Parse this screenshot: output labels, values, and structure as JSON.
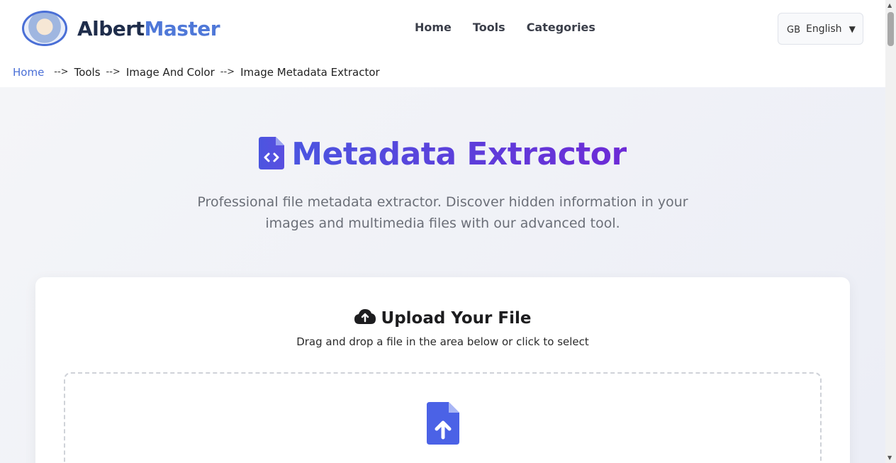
{
  "brand": {
    "part1": "Albert",
    "part2": "Master"
  },
  "nav": {
    "items": [
      "Home",
      "Tools",
      "Categories"
    ]
  },
  "lang": {
    "flag": "GB",
    "label": "English",
    "caret": "▼"
  },
  "breadcrumb": {
    "home": "Home",
    "sep": "-->",
    "items": [
      "Tools",
      "Image And Color",
      "Image Metadata Extractor"
    ]
  },
  "hero": {
    "title": "Metadata Extractor",
    "subtitle": "Professional file metadata extractor. Discover hidden information in your images and multimedia files with our advanced tool."
  },
  "upload": {
    "title": "Upload Your File",
    "subtitle": "Drag and drop a file in the area below or click to select"
  },
  "colors": {
    "accent": "#4b5be6",
    "purple": "#6d2ad6",
    "link": "#4a6fd6"
  },
  "icons": {
    "title_icon": "file-code-icon",
    "upload_title_icon": "cloud-upload-icon",
    "drop_icon": "file-upload-icon"
  }
}
